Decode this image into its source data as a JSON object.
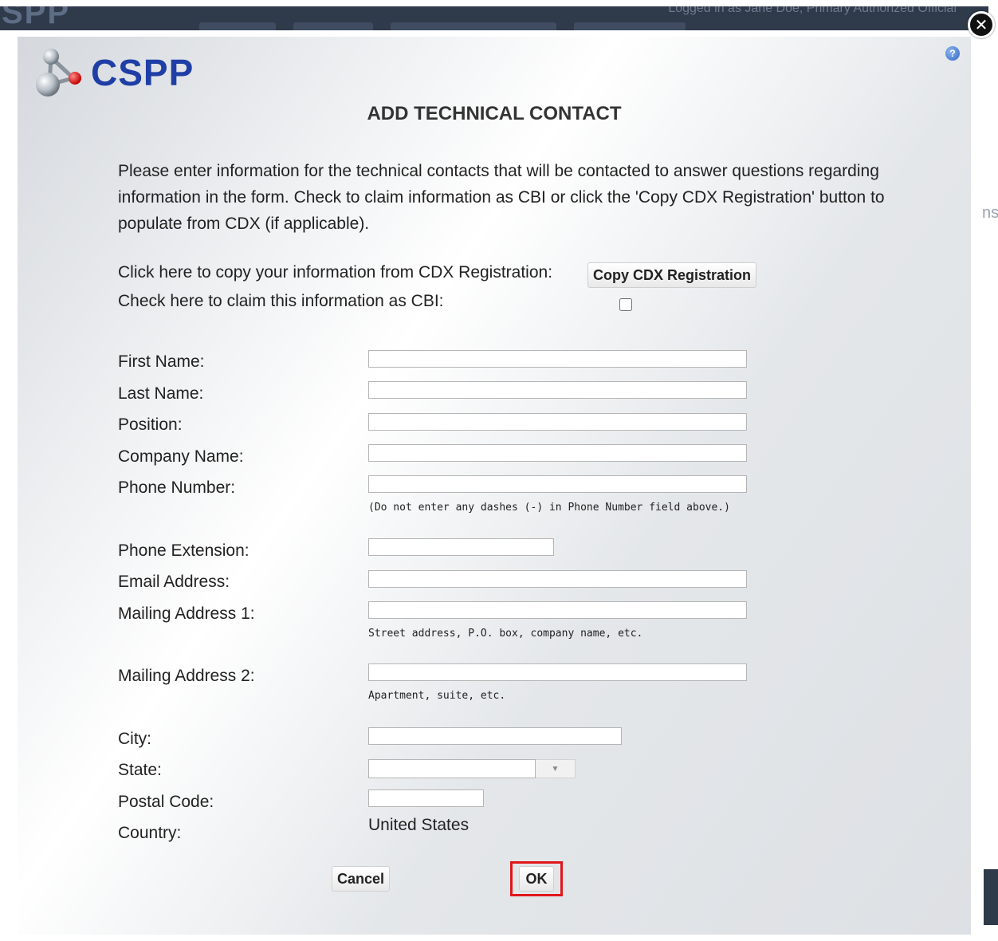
{
  "background": {
    "logo_text": "SPP",
    "login_text": "Logged in as Jane Doe, Primary Authorized Official",
    "right_edge_text": "ns"
  },
  "dialog": {
    "logo_text": "CSPP",
    "title": "ADD TECHNICAL CONTACT",
    "intro": "Please enter information for the technical contacts that will be contacted to answer questions regarding information in the form. Check to claim information as CBI or click the 'Copy CDX Registration' button to populate from CDX (if applicable).",
    "copy_label": "Click here to copy your information from CDX Registration:",
    "copy_button": "Copy CDX Registration",
    "cbi_label": "Check here to claim this information as CBI:",
    "cbi_checked": false,
    "help_icon": "question-circle-icon",
    "close_icon": "close-circle-icon"
  },
  "fields": {
    "first_name": {
      "label": "First Name:",
      "value": ""
    },
    "last_name": {
      "label": "Last Name:",
      "value": ""
    },
    "position": {
      "label": "Position:",
      "value": ""
    },
    "company_name": {
      "label": "Company Name:",
      "value": ""
    },
    "phone_number": {
      "label": "Phone Number:",
      "value": "",
      "hint": "(Do not enter any dashes (-) in Phone Number field above.)"
    },
    "phone_extension": {
      "label": "Phone Extension:",
      "value": ""
    },
    "email_address": {
      "label": "Email Address:",
      "value": ""
    },
    "mailing_address_1": {
      "label": "Mailing Address 1:",
      "value": "",
      "hint": "Street address, P.O. box, company name, etc."
    },
    "mailing_address_2": {
      "label": "Mailing Address 2:",
      "value": "",
      "hint": "Apartment, suite, etc."
    },
    "city": {
      "label": "City:",
      "value": ""
    },
    "state": {
      "label": "State:",
      "value": ""
    },
    "postal_code": {
      "label": "Postal Code:",
      "value": ""
    },
    "country": {
      "label": "Country:",
      "value": "United States"
    }
  },
  "buttons": {
    "cancel": "Cancel",
    "ok": "OK"
  },
  "colors": {
    "logo_blue": "#1f3ea6",
    "highlight_red": "#e0161b"
  }
}
